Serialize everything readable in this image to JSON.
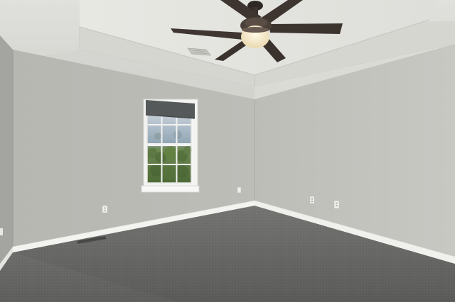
{
  "scene": {
    "kind": "photo",
    "subject": "empty room",
    "colors": {
      "wall_left": "#b9b9b4",
      "wall_back": "#bcbcb7",
      "wall_right": "#c4c4bf",
      "ceiling": "#d9d9d4",
      "tray_ceiling": "#e4e4df",
      "baseboard": "#f3f3f0",
      "carpet": "#6d6d6b",
      "window_frame": "#f4f4f2",
      "window_shade": "#55595a",
      "foliage": "#5f7a45",
      "sky": "#c9d3dc",
      "fan_blade": "#3e3530",
      "fan_light": "#f4e8c8"
    },
    "objects": [
      "ceiling-fan",
      "window",
      "window-shade",
      "baseboard",
      "carpet",
      "electrical-outlet",
      "floor-vent",
      "ceiling-vent"
    ]
  }
}
